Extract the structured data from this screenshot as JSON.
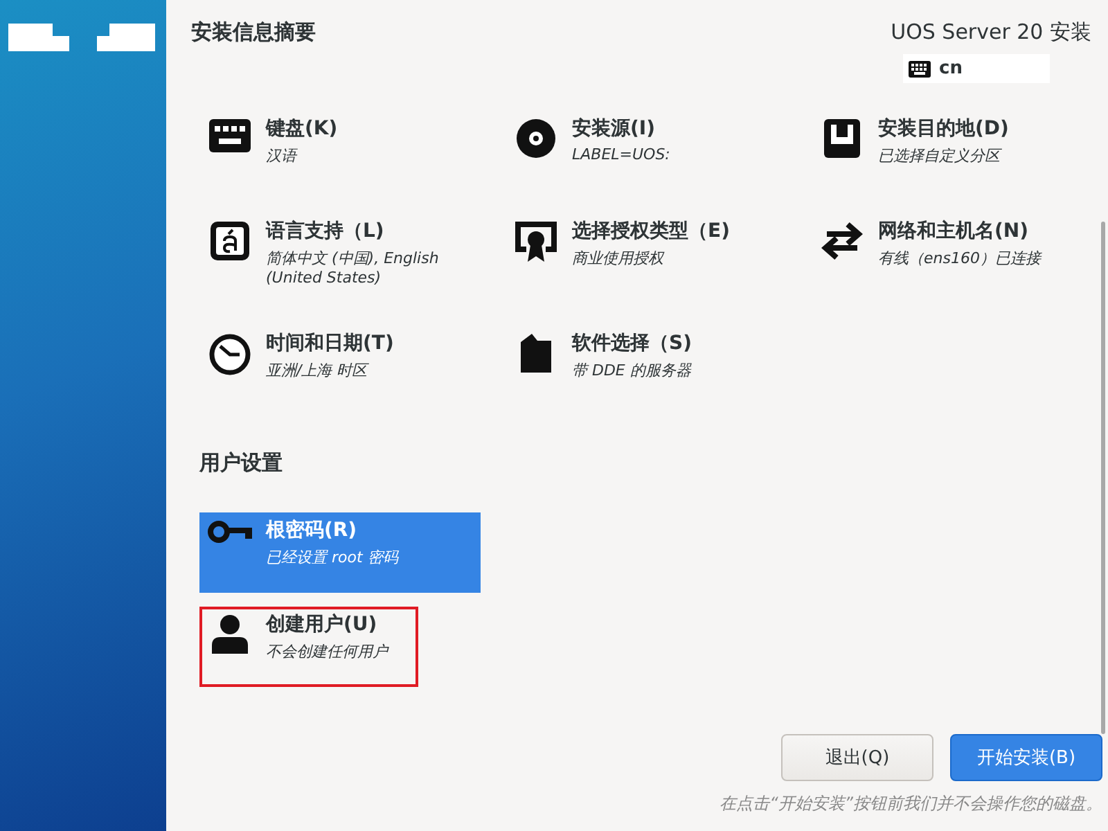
{
  "header": {
    "title": "安装信息摘要",
    "product": "UOS Server 20 安装",
    "keyboard_layout": "cn"
  },
  "sections": [
    {
      "items": [
        {
          "kind": "keyboard",
          "title": "键盘(K)",
          "status": "汉语",
          "selected": false,
          "warning": false
        },
        {
          "kind": "disc",
          "title": "安装源(I)",
          "status": "LABEL=UOS:",
          "selected": false,
          "warning": false
        },
        {
          "kind": "drive",
          "title": "安装目的地(D)",
          "status": "已选择自定义分区",
          "selected": false,
          "warning": false
        },
        {
          "kind": "language",
          "title": "语言支持（L)",
          "status": "简体中文 (中国), English (United States)",
          "selected": false,
          "warning": false
        },
        {
          "kind": "certificate",
          "title": "选择授权类型（E)",
          "status": "商业使用授权",
          "selected": false,
          "warning": false
        },
        {
          "kind": "network",
          "title": "网络和主机名(N)",
          "status": "有线（ens160）已连接",
          "selected": false,
          "warning": false
        },
        {
          "kind": "clock",
          "title": "时间和日期(T)",
          "status": "亚洲/上海 时区",
          "selected": false,
          "warning": false
        },
        {
          "kind": "package",
          "title": "软件选择（S)",
          "status": "带 DDE 的服务器",
          "selected": false,
          "warning": false
        }
      ]
    },
    {
      "title": "用户设置",
      "items": [
        {
          "kind": "key",
          "title": "根密码(R)",
          "status": "已经设置 root 密码",
          "selected": true,
          "warning": false
        },
        {
          "kind": "user",
          "title": "创建用户(U)",
          "status": "不会创建任何用户",
          "selected": false,
          "warning": true
        }
      ]
    }
  ],
  "footer": {
    "buttons": [
      {
        "label": "退出(Q)",
        "kind": "secondary"
      },
      {
        "label": "开始安装(B)",
        "kind": "primary"
      }
    ],
    "note": "在点击“开始安装”按钮前我们并不会操作您的磁盘。"
  }
}
